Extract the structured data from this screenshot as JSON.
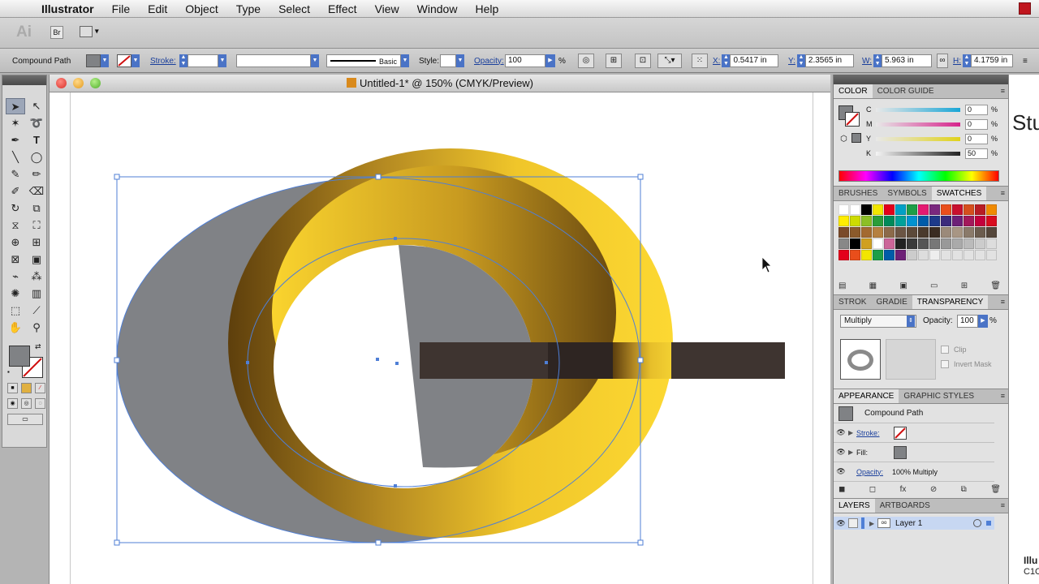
{
  "menubar": {
    "app_name": "Illustrator",
    "items": [
      "File",
      "Edit",
      "Object",
      "Type",
      "Select",
      "Effect",
      "View",
      "Window",
      "Help"
    ]
  },
  "appbar": {
    "logo": "Ai",
    "bridge": "Br"
  },
  "control": {
    "selection_type": "Compound Path",
    "stroke_label": "Stroke:",
    "brush_style": "Basic",
    "style_label": "Style:",
    "opacity_label": "Opacity:",
    "opacity_value": "100",
    "opacity_unit": "%",
    "x_label": "X:",
    "x_value": "0.5417 in",
    "y_label": "Y:",
    "y_value": "2.3565 in",
    "w_label": "W:",
    "w_value": "5.963 in",
    "h_label": "H:",
    "h_value": "4.1759 in"
  },
  "document": {
    "title": "Untitled-1* @ 150% (CMYK/Preview)"
  },
  "color_panel": {
    "tabs": [
      "COLOR",
      "COLOR GUIDE"
    ],
    "channels": [
      {
        "label": "C",
        "value": "0",
        "color": "#1aa6d6"
      },
      {
        "label": "M",
        "value": "0",
        "color": "#d6248c"
      },
      {
        "label": "Y",
        "value": "0",
        "color": "#e0d21a"
      },
      {
        "label": "K",
        "value": "50",
        "color": "#222222"
      }
    ],
    "unit": "%"
  },
  "swatches_panel": {
    "tabs": [
      "BRUSHES",
      "SYMBOLS",
      "SWATCHES"
    ]
  },
  "transparency_panel": {
    "tabs": [
      "STROK",
      "GRADIE",
      "TRANSPARENCY"
    ],
    "blend_mode": "Multiply",
    "opacity_label": "Opacity:",
    "opacity_value": "100",
    "unit": "%",
    "clip_label": "Clip",
    "invert_label": "Invert Mask"
  },
  "appearance_panel": {
    "tabs": [
      "APPEARANCE",
      "GRAPHIC STYLES"
    ],
    "object": "Compound Path",
    "stroke_label": "Stroke:",
    "fill_label": "Fill:",
    "opacity_label": "Opacity:",
    "opacity_value": "100% Multiply"
  },
  "layers_panel": {
    "tabs": [
      "LAYERS",
      "ARTBOARDS"
    ],
    "layer_name": "Layer 1"
  },
  "background_window": {
    "heading": "Stu",
    "line1": "Illu",
    "line2": "C1C"
  },
  "colors": {
    "gold_dark": "#6b4a10",
    "gold_light": "#f7cc2a",
    "gray_shape": "#808286",
    "bar_brown": "#3e3430",
    "selection_blue": "#4f7fd6"
  }
}
